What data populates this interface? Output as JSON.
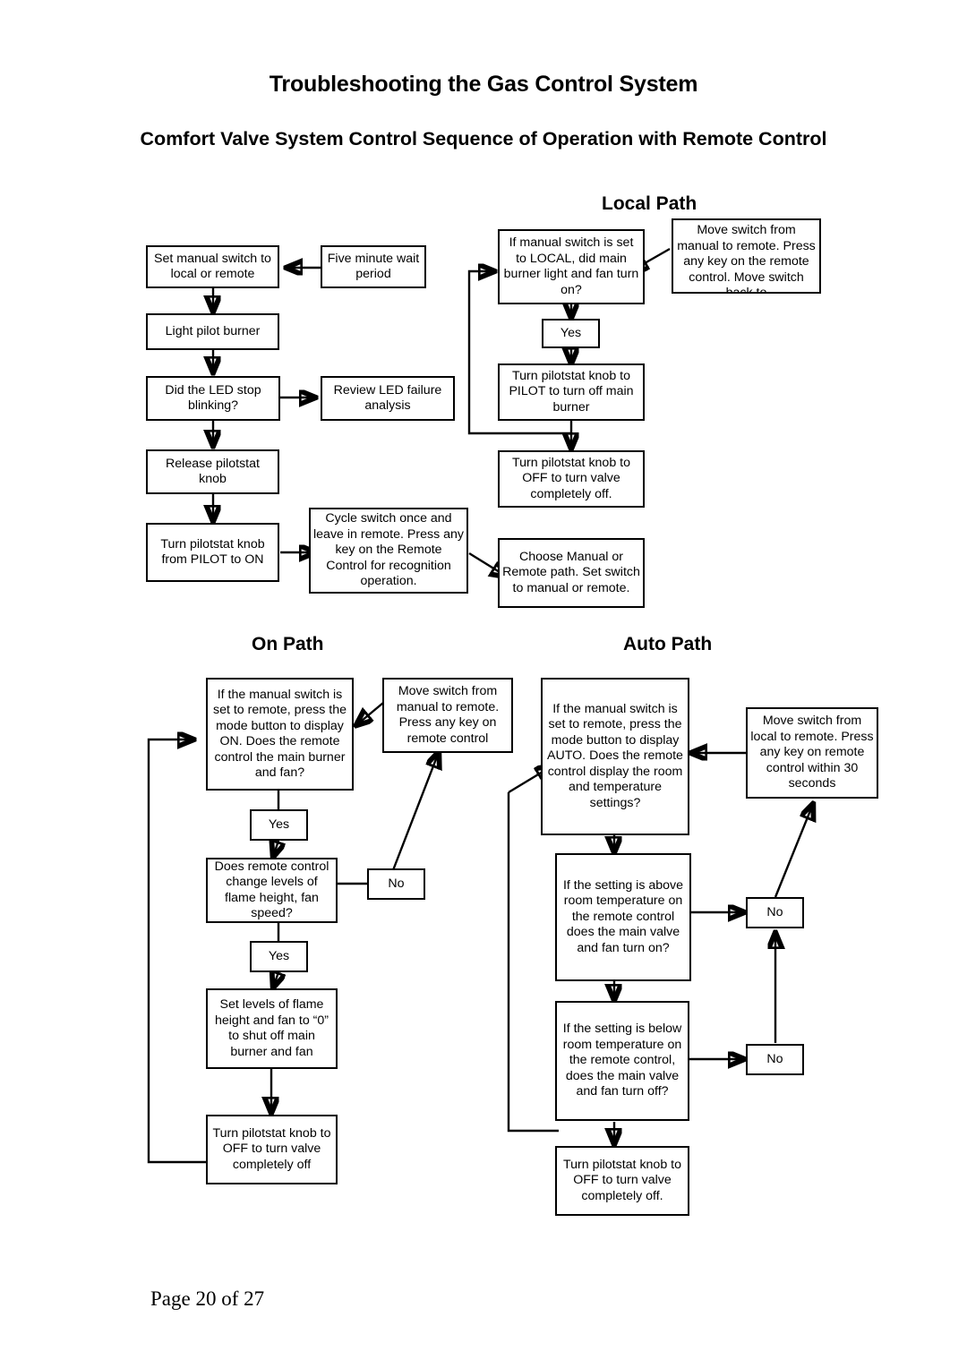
{
  "document": {
    "title": "Troubleshooting the Gas Control System",
    "subtitle": "Comfort Valve System Control Sequence of Operation with Remote Control",
    "footer": "Page 20 of 27"
  },
  "sections": {
    "local": {
      "label": "Local Path"
    },
    "on": {
      "label": "On Path"
    },
    "auto": {
      "label": "Auto Path"
    }
  },
  "chart_data": {
    "type": "diagram",
    "title": "Comfort Valve System Control Sequence of Operation with Remote Control",
    "subgraphs": [
      "Local Path",
      "On Path",
      "Auto Path"
    ],
    "nodes": [
      {
        "id": "L1",
        "group": "Local Path",
        "text": "Set manual switch to local or remote"
      },
      {
        "id": "L2",
        "group": "Local Path",
        "text": "Five minute wait period"
      },
      {
        "id": "L3",
        "group": "Local Path",
        "text": "Light pilot burner"
      },
      {
        "id": "L4",
        "group": "Local Path",
        "text": "Did the LED stop blinking?"
      },
      {
        "id": "L5",
        "group": "Local Path",
        "text": "Review LED failure analysis"
      },
      {
        "id": "L6",
        "group": "Local Path",
        "text": "Release pilotstat knob"
      },
      {
        "id": "L7",
        "group": "Local Path",
        "text": "Turn pilotstat knob from PILOT to ON"
      },
      {
        "id": "L8",
        "group": "Local Path",
        "text": "Cycle switch once and leave in remote. Press any key on the Remote Control for recognition operation."
      },
      {
        "id": "L9",
        "group": "Local Path",
        "text": "If manual switch is set to LOCAL, did main burner light and fan turn on?"
      },
      {
        "id": "L10",
        "group": "Local Path",
        "text": "Move switch from manual to remote. Press any key on the remote control. Move switch back to"
      },
      {
        "id": "L11",
        "group": "Local Path",
        "text": "Yes"
      },
      {
        "id": "L12",
        "group": "Local Path",
        "text": "Turn pilotstat knob to PILOT to turn off main burner"
      },
      {
        "id": "L13",
        "group": "Local Path",
        "text": "Turn pilotstat knob to OFF to turn valve completely off."
      },
      {
        "id": "L14",
        "group": "Local Path",
        "text": "Choose Manual or Remote path. Set switch to manual or remote."
      },
      {
        "id": "O1",
        "group": "On Path",
        "text": "If the manual switch is set to remote, press the mode button to display ON. Does the remote control the main burner and fan?"
      },
      {
        "id": "O2",
        "group": "On Path",
        "text": "Move switch from manual to remote. Press any key on remote control"
      },
      {
        "id": "O3",
        "group": "On Path",
        "text": "Yes"
      },
      {
        "id": "O4",
        "group": "On Path",
        "text": "Does remote control change levels of flame height, fan speed?"
      },
      {
        "id": "O5",
        "group": "On Path",
        "text": "No"
      },
      {
        "id": "O6",
        "group": "On Path",
        "text": "Yes"
      },
      {
        "id": "O7",
        "group": "On Path",
        "text": "Set levels of flame height and fan to “0” to shut off main burner and fan"
      },
      {
        "id": "O8",
        "group": "On Path",
        "text": "Turn pilotstat knob to OFF to turn valve completely off"
      },
      {
        "id": "A1",
        "group": "Auto Path",
        "text": "If the manual switch is set to remote, press the mode button to display AUTO.  Does the remote control display the room and temperature settings?"
      },
      {
        "id": "A2",
        "group": "Auto Path",
        "text": "Move switch from local to remote. Press any key on remote control within 30 seconds"
      },
      {
        "id": "A3",
        "group": "Auto Path",
        "text": "If the setting is above room temperature on the remote control does the main valve and fan turn on?"
      },
      {
        "id": "A4",
        "group": "Auto Path",
        "text": "No"
      },
      {
        "id": "A5",
        "group": "Auto Path",
        "text": "If the setting is below room temperature on the remote control, does the main valve and fan turn off?"
      },
      {
        "id": "A6",
        "group": "Auto Path",
        "text": "No"
      },
      {
        "id": "A7",
        "group": "Auto Path",
        "text": "Turn pilotstat knob to OFF to turn valve completely off."
      }
    ],
    "edges": [
      {
        "from": "L2",
        "to": "L1"
      },
      {
        "from": "L1",
        "to": "L3"
      },
      {
        "from": "L3",
        "to": "L4"
      },
      {
        "from": "L4",
        "to": "L5"
      },
      {
        "from": "L4",
        "to": "L6"
      },
      {
        "from": "L6",
        "to": "L7"
      },
      {
        "from": "L7",
        "to": "L8"
      },
      {
        "from": "L8",
        "to": "L14"
      },
      {
        "from": "L10",
        "to": "L9"
      },
      {
        "from": "L9",
        "to": "L11"
      },
      {
        "from": "L11",
        "to": "L12"
      },
      {
        "from": "L12",
        "to": "L13"
      },
      {
        "from": "L12",
        "to": "L9"
      },
      {
        "from": "O2",
        "to": "O1"
      },
      {
        "from": "O1",
        "to": "O3"
      },
      {
        "from": "O3",
        "to": "O4"
      },
      {
        "from": "O4",
        "to": "O5"
      },
      {
        "from": "O5",
        "to": "O2"
      },
      {
        "from": "O4",
        "to": "O6"
      },
      {
        "from": "O6",
        "to": "O7"
      },
      {
        "from": "O7",
        "to": "O8"
      },
      {
        "from": "O8",
        "to": "O1"
      },
      {
        "from": "A2",
        "to": "A1"
      },
      {
        "from": "A1",
        "to": "A3"
      },
      {
        "from": "A3",
        "to": "A4"
      },
      {
        "from": "A4",
        "to": "A2"
      },
      {
        "from": "A3",
        "to": "A5"
      },
      {
        "from": "A5",
        "to": "A6"
      },
      {
        "from": "A6",
        "to": "A4"
      },
      {
        "from": "A5",
        "to": "A7"
      },
      {
        "from": "A7",
        "to": "A1"
      }
    ]
  },
  "nodes": {
    "L1": "Set manual switch to local or remote",
    "L2": "Five minute wait period",
    "L3": "Light pilot burner",
    "L4": "Did the LED stop blinking?",
    "L5": "Review LED failure analysis",
    "L6": "Release pilotstat knob",
    "L7": "Turn pilotstat knob from PILOT to ON",
    "L8": "Cycle switch once and leave in remote. Press any key on the Remote Control for recognition operation.",
    "L9": "If manual switch is set to LOCAL, did main burner light and fan turn on?",
    "L10": "Move switch from manual to remote. Press any key on the remote control. Move switch back to",
    "L11": "Yes",
    "L12": "Turn pilotstat knob to PILOT to turn off main burner",
    "L13": "Turn pilotstat knob to OFF to turn valve completely off.",
    "L14": "Choose Manual or Remote path. Set switch to manual or remote.",
    "O1": "If the manual switch is set to remote, press the mode button to display ON. Does the remote control the main burner and fan?",
    "O2": "Move switch from manual to remote. Press any key on remote control",
    "O3": "Yes",
    "O4": "Does remote control change levels of flame height, fan speed?",
    "O5": "No",
    "O6": "Yes",
    "O7": "Set levels of flame height and fan to “0” to shut off main burner and fan",
    "O8": "Turn pilotstat knob to OFF to turn valve completely off",
    "A1": "If the manual switch is set to remote, press the mode button to display AUTO.  Does the remote control display the room and temperature settings?",
    "A2": "Move switch from local to remote. Press any key on remote control within 30 seconds",
    "A3": "If the setting is above room temperature on the remote control does the main valve and fan turn on?",
    "A4": "No",
    "A5": "If the setting is below room temperature on the remote control, does the main valve and fan turn off?",
    "A6": "No",
    "A7": "Turn pilotstat knob to OFF to turn valve completely off."
  }
}
